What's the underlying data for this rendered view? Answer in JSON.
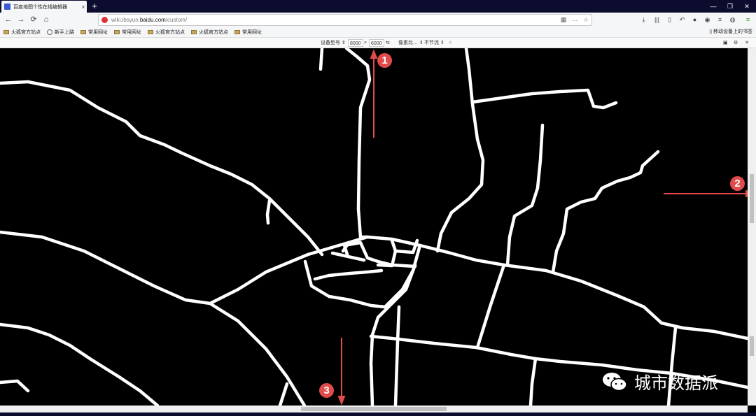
{
  "tab": {
    "title": "百度地图个性在线编辑器",
    "close": "×"
  },
  "newtab": "+",
  "window": {
    "minimize": "—",
    "restore": "❐",
    "close": "✕"
  },
  "nav": {
    "back": "←",
    "forward": "→",
    "reload": "⟳",
    "home": "⌂"
  },
  "url": {
    "prefix": "wiki.lbsyun.",
    "domain": "baidu.com",
    "path": "/custom/"
  },
  "url_actions": {
    "qr": "▦",
    "more": "···",
    "star": "☆"
  },
  "bookmarks": [
    {
      "label": "火狐官方站点",
      "icon": "folder"
    },
    {
      "label": "新手上路",
      "icon": "globe"
    },
    {
      "label": "常用网址",
      "icon": "folder"
    },
    {
      "label": "常用网址",
      "icon": "folder"
    },
    {
      "label": "火狐官方站点",
      "icon": "folder"
    },
    {
      "label": "火狐官方站点",
      "icon": "folder"
    },
    {
      "label": "常用网址",
      "icon": "folder"
    }
  ],
  "bookmarks_right": "移动设备上的书签",
  "devbar": {
    "device_label": "设备型号 ⇕",
    "width": "8000",
    "times": "×",
    "height": "6000",
    "pixel_ratio": "像素比… ⇕",
    "throttle": "不节流 ⇕"
  },
  "markers": [
    "1",
    "2",
    "3"
  ],
  "watermark": "城市数据派",
  "colors": {
    "titlebar": "#0c0c2e",
    "marker": "#e24b4b",
    "road": "#ffffff",
    "map_bg": "#000000"
  }
}
